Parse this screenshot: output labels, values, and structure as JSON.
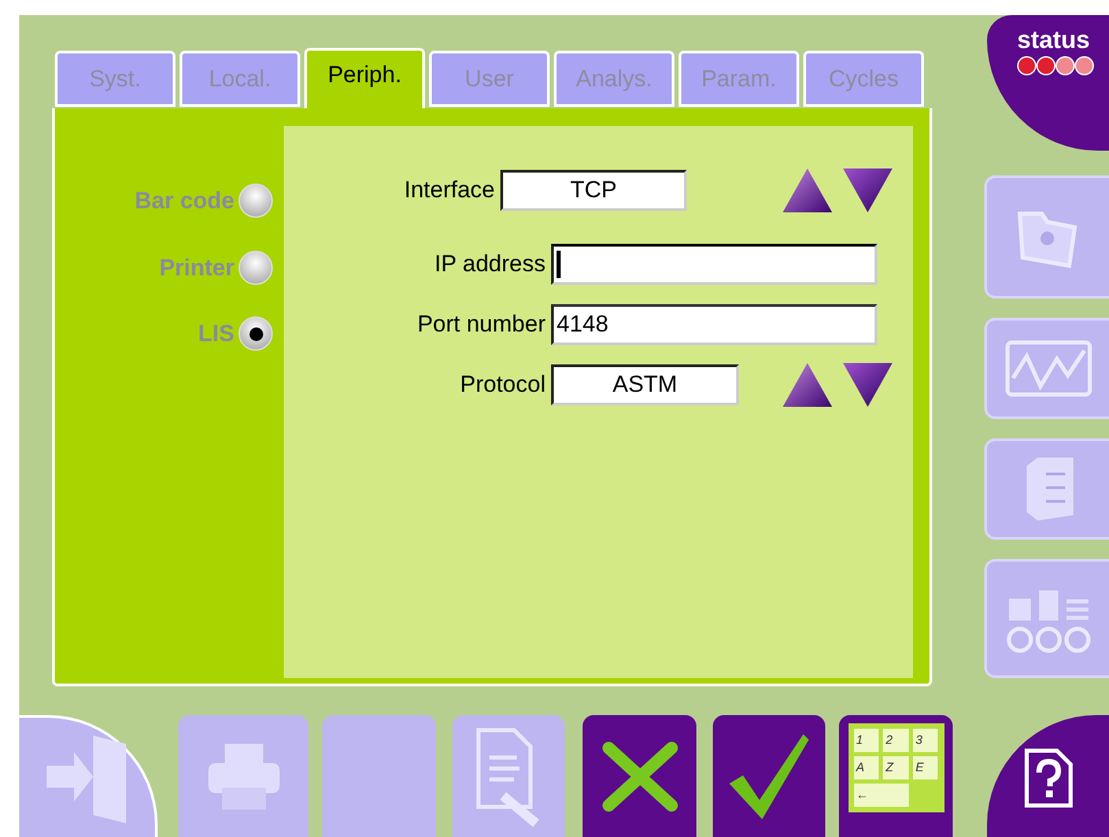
{
  "status": {
    "label": "status"
  },
  "tabs": [
    {
      "label": "Syst.",
      "selected": false
    },
    {
      "label": "Local.",
      "selected": false
    },
    {
      "label": "Periph.",
      "selected": true
    },
    {
      "label": "User",
      "selected": false
    },
    {
      "label": "Analys.",
      "selected": false
    },
    {
      "label": "Param.",
      "selected": false
    },
    {
      "label": "Cycles",
      "selected": false
    }
  ],
  "devices": [
    {
      "label": "Bar code",
      "selected": false
    },
    {
      "label": "Printer",
      "selected": false
    },
    {
      "label": "LIS",
      "selected": true
    }
  ],
  "interface": {
    "label": "Interface",
    "value": "TCP"
  },
  "fields": [
    {
      "kind": "text",
      "label": "IP address",
      "focused": true
    },
    {
      "kind": "text",
      "label": "Port number",
      "value": "4148",
      "focused": false
    },
    {
      "kind": "spinner",
      "label": "Protocol",
      "value": "ASTM"
    }
  ],
  "side_buttons": [
    {
      "kind": "folder",
      "disabled": true
    },
    {
      "kind": "chart",
      "disabled": true
    },
    {
      "kind": "book",
      "disabled": true
    },
    {
      "kind": "layout",
      "disabled": true
    }
  ],
  "bottom_buttons": [
    {
      "kind": "exit",
      "disabled": true
    },
    {
      "kind": "print",
      "disabled": true
    },
    {
      "kind": "blank",
      "disabled": true
    },
    {
      "kind": "edit",
      "disabled": true
    },
    {
      "kind": "cancel",
      "disabled": false
    },
    {
      "kind": "confirm",
      "disabled": false
    },
    {
      "kind": "keyboard",
      "disabled": false
    },
    {
      "kind": "help",
      "disabled": false
    }
  ],
  "keypad": {
    "keys": [
      "1",
      "2",
      "3",
      "A",
      "Z",
      "E",
      "←"
    ]
  }
}
